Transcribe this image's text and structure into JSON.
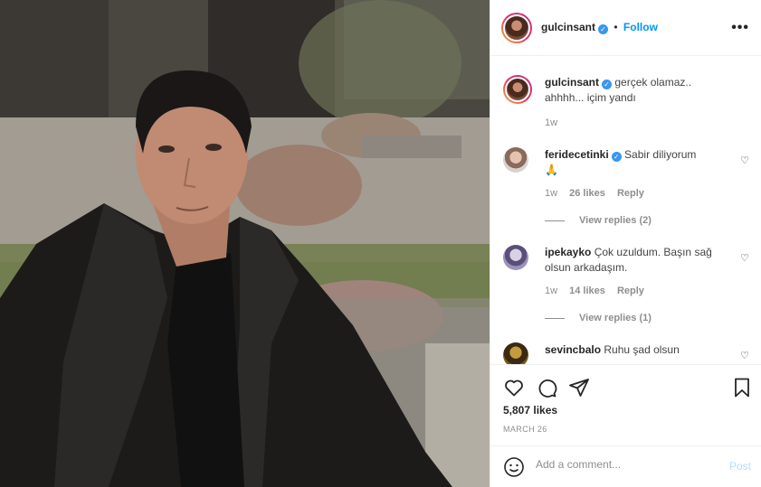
{
  "header": {
    "username": "gulcinsant",
    "follow_label": "Follow",
    "more_glyph": "•••",
    "dot": "•"
  },
  "comments": [
    {
      "username": "gulcinsant",
      "text": "gerçek olamaz.. ahhhh... içim yandı",
      "time": "1w",
      "verified": true
    },
    {
      "username": "feridecetinki",
      "text": "Sabir diliyorum",
      "emoji": "🙏",
      "time": "1w",
      "likes": "26 likes",
      "reply": "Reply",
      "view_replies": "View replies (2)",
      "verified": true
    },
    {
      "username": "ipekayko",
      "text": "Çok uzuldum. Başın sağ olsun arkadaşım.",
      "time": "1w",
      "likes": "14 likes",
      "reply": "Reply",
      "view_replies": "View replies (1)"
    },
    {
      "username": "sevincbalo",
      "text": "Ruhu şad olsun"
    }
  ],
  "post": {
    "likes": "5,807 likes",
    "date": "MARCH 26"
  },
  "composer": {
    "placeholder": "Add a comment...",
    "post_label": "Post"
  },
  "icons": {
    "more": "more-options-icon",
    "heart": "heart-icon",
    "comment": "comment-icon",
    "share": "share-icon",
    "save": "bookmark-icon",
    "emoji": "emoji-icon",
    "verified": "verified-icon"
  },
  "colors": {
    "accent": "#0095f6",
    "verified": "#3897f0",
    "muted": "#8e8e8e",
    "post_disabled": "#b2dffc"
  }
}
